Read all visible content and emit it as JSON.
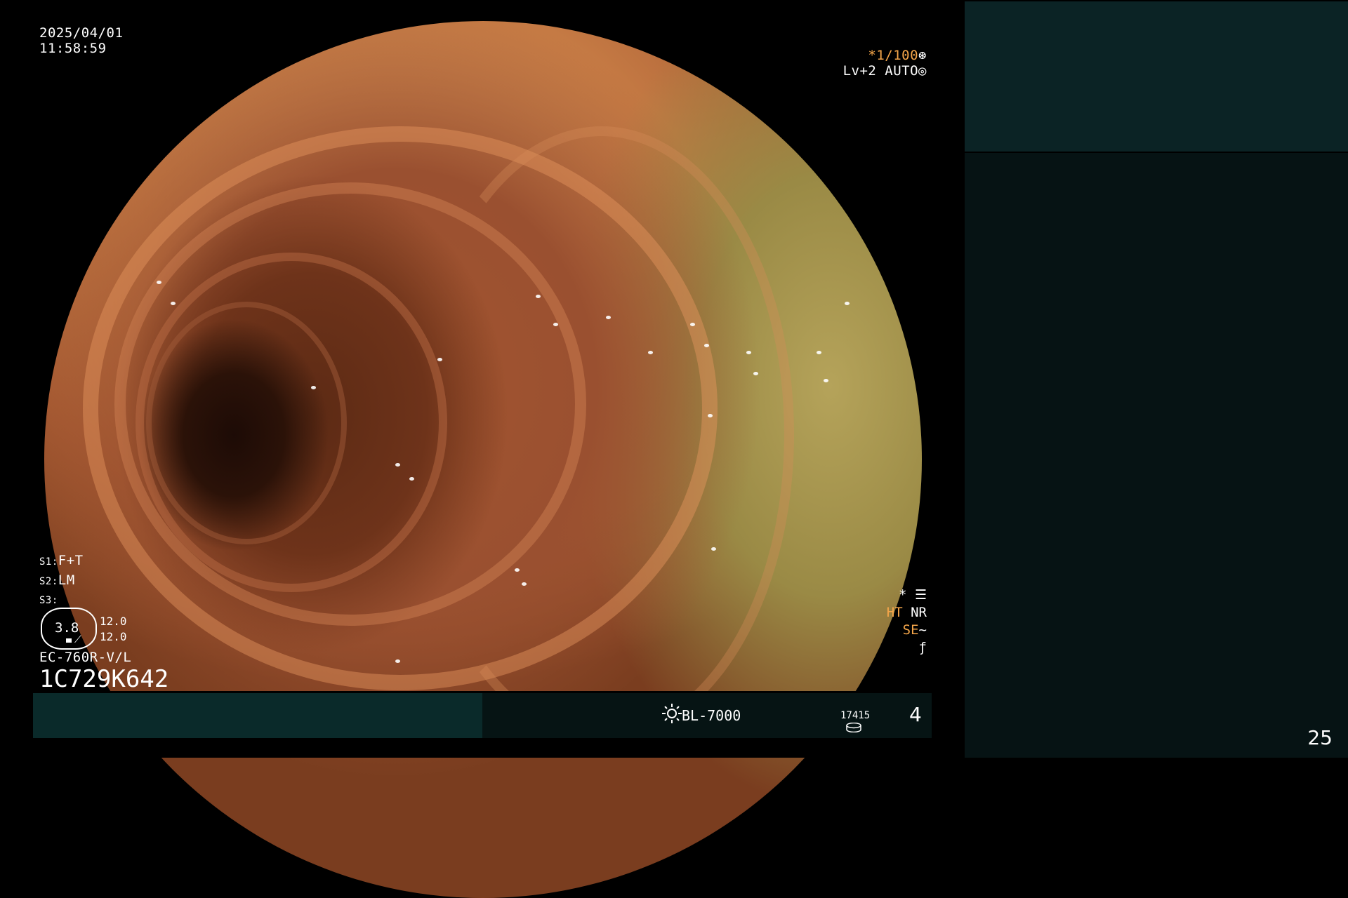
{
  "overlay": {
    "date": "2025/04/01",
    "time": "11:58:59",
    "shutter": "*1/100",
    "shutter_icon": "aperture-icon",
    "level": "Lv+2",
    "mode": "AUTO",
    "mode_icon": "iris-icon"
  },
  "scope_settings": {
    "s1_label": "S1:",
    "s1_value": "F+T",
    "s2_label": "S2:",
    "s2_value": "LM",
    "s3_label": "S3:",
    "s3_value": ""
  },
  "gauge": {
    "value": "3.8",
    "upper": "12.0",
    "lower": "12.0"
  },
  "scope": {
    "model": "EC-760R-V/L",
    "serial": "1C729K642"
  },
  "indicators": {
    "star": "*",
    "star_icon": "settings-list-icon",
    "ht": "HT",
    "nr": "NR",
    "se": "SE",
    "se_icon": "curve-icon",
    "freeze_icon": "slash-f-icon"
  },
  "status_bar": {
    "light_icon": "sun-icon",
    "light_source": "BL-7000",
    "counter": "17415",
    "counter_icon": "disk-icon",
    "frame_index": "4"
  },
  "side_panel": {
    "page_number": "25"
  },
  "colors": {
    "orange": "#f5a64a",
    "status_bar": "#061414",
    "status_teal": "#0a2a2a",
    "side_top": "#0b2325",
    "side_bottom": "#061314"
  }
}
